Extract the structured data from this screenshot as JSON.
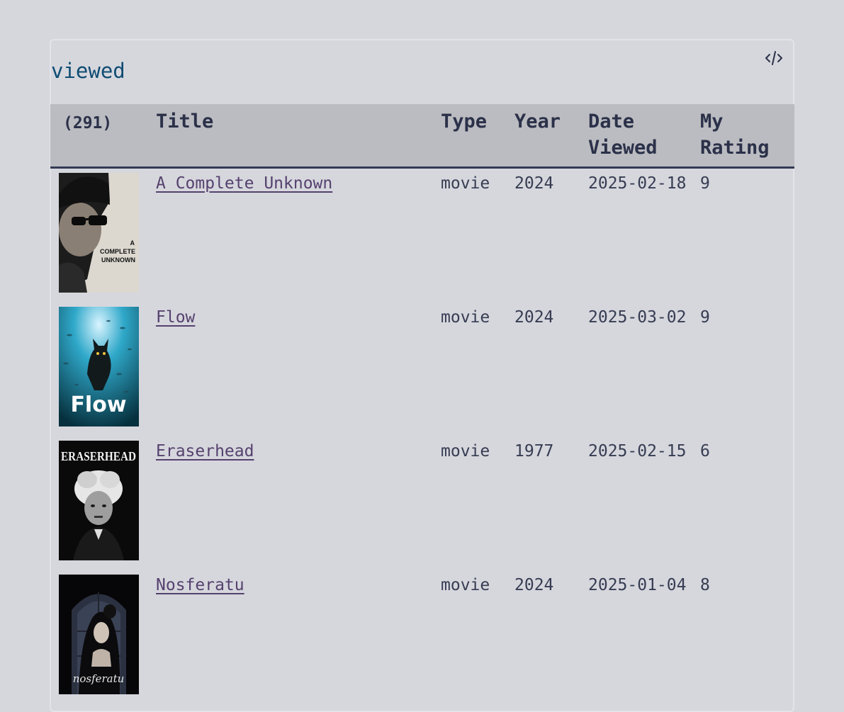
{
  "heading": "viewed",
  "table": {
    "columns": {
      "count": "(291)",
      "title": "Title",
      "type": "Type",
      "year": "Year",
      "date_viewed": "Date Viewed",
      "my_rating": "My Rating"
    },
    "rows": [
      {
        "title": "A Complete Unknown",
        "type": "movie",
        "year": "2024",
        "date_viewed": "2025-02-18",
        "my_rating": "9",
        "poster_icon": "a-complete-unknown-poster",
        "poster_text": "A COMPLETE UNKNOWN"
      },
      {
        "title": "Flow",
        "type": "movie",
        "year": "2024",
        "date_viewed": "2025-03-02",
        "my_rating": "9",
        "poster_icon": "flow-poster",
        "poster_text": "Flow"
      },
      {
        "title": "Eraserhead",
        "type": "movie",
        "year": "1977",
        "date_viewed": "2025-02-15",
        "my_rating": "6",
        "poster_icon": "eraserhead-poster",
        "poster_text": "ERASERHEAD"
      },
      {
        "title": "Nosferatu",
        "type": "movie",
        "year": "2024",
        "date_viewed": "2025-01-04",
        "my_rating": "8",
        "poster_icon": "nosferatu-poster",
        "poster_text": "nosferatu"
      }
    ]
  },
  "toolbar": {
    "embed_icon": "code-embed-icon"
  }
}
